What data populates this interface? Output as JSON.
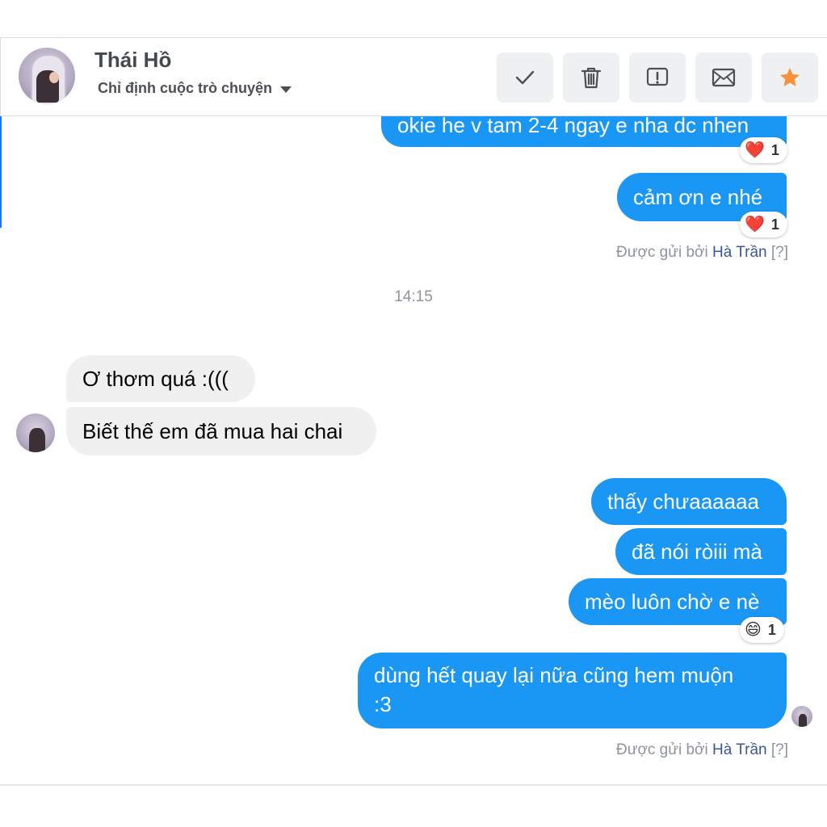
{
  "header": {
    "contact_name": "Thái Hồ",
    "assign_label": "Chỉ định cuộc trò chuyện",
    "actions": [
      "check-icon",
      "trash-icon",
      "report-icon",
      "mail-icon",
      "star-icon"
    ]
  },
  "messages": {
    "m1_text": "okie he v tam 2-4 ngay e nha dc nhen",
    "m1_reaction_count": "1",
    "m2_text": "cảm ơn e nhé",
    "m2_reaction_count": "1",
    "sent_by_1": {
      "prefix": "Được gửi bởi",
      "name": "Hà Trần",
      "help": "[?]"
    },
    "timestamp": "14:15",
    "in1_text": "Ơ thơm quá :(((",
    "in2_text": "Biết thế em đã mua hai chai",
    "m3_text": "thấy chưaaaaaa",
    "m4_text": "đã nói ròiii mà",
    "m5_text": "mèo luôn chờ e nè",
    "m5_reaction_count": "1",
    "m6_line1": "dùng hết quay lại nữa cũng hem muộn",
    "m6_line2": ":3",
    "sent_by_2": {
      "prefix": "Được gửi bởi",
      "name": "Hà Trần",
      "help": "[?]"
    }
  },
  "reactions": {
    "heart": "❤️",
    "laugh": "😄"
  },
  "colors": {
    "outgoing": "#1a96f4",
    "incoming": "#f0f0f0",
    "star": "#f7923a",
    "link": "#385898"
  }
}
